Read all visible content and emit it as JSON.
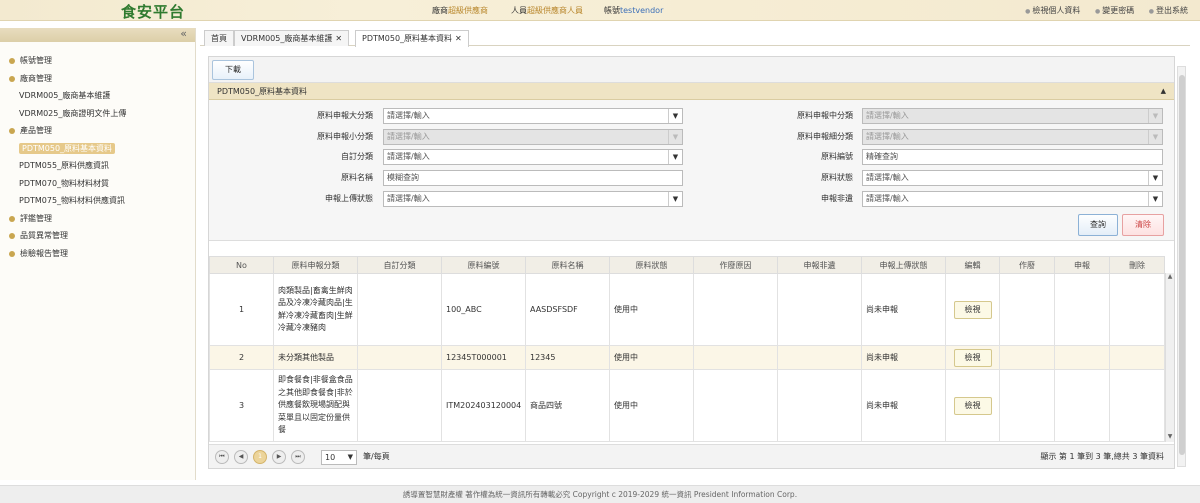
{
  "header": {
    "logo": "食安平台",
    "company_label": "廠商",
    "company_value": "超級供應商",
    "person_label": "人員",
    "person_value": "超級供應商人員",
    "account_label": "帳號",
    "account_value": "testvendor",
    "links": [
      "檢視個人資料",
      "變更密碼",
      "登出系統"
    ]
  },
  "sidebar": {
    "collapse_icon": "«",
    "groups": [
      {
        "label": "帳號管理"
      },
      {
        "label": "廠商管理",
        "items": [
          "VDRM005_廠商基本維護",
          "VDRM025_廠商證明文件上傳"
        ]
      },
      {
        "label": "產品管理",
        "items": [
          "PDTM050_原料基本資料",
          "PDTM055_原料供應資訊",
          "PDTM070_物料材料材質",
          "PDTM075_物料材料供應資訊"
        ]
      },
      {
        "label": "評鑑管理"
      },
      {
        "label": "品質異常管理"
      },
      {
        "label": "檢驗報告管理"
      }
    ],
    "active_item": "PDTM050_原料基本資料"
  },
  "tabs": [
    {
      "label": "首頁",
      "closable": false
    },
    {
      "label": "VDRM005_廠商基本維護",
      "closable": true
    },
    {
      "label": "PDTM050_原料基本資料",
      "closable": true,
      "active": true
    }
  ],
  "toolbar": {
    "download_label": "下載"
  },
  "section": {
    "title": "PDTM050_原料基本資料",
    "toggle": "▲"
  },
  "form": {
    "major_category": {
      "label": "原料申報大分類",
      "placeholder": "請選擇/輸入"
    },
    "middle_category": {
      "label": "原料申報中分類",
      "placeholder": "請選擇/輸入"
    },
    "minor_category": {
      "label": "原料申報小分類",
      "placeholder": "請選擇/輸入"
    },
    "detail_category": {
      "label": "原料申報細分類",
      "placeholder": "請選擇/輸入"
    },
    "custom_category": {
      "label": "自訂分類",
      "placeholder": "請選擇/輸入"
    },
    "material_code": {
      "label": "原料編號",
      "placeholder": "精確查詢"
    },
    "material_name": {
      "label": "原料名稱",
      "placeholder": "模糊查詢"
    },
    "material_status": {
      "label": "原料狀態",
      "placeholder": "請選擇/輸入"
    },
    "upload_status": {
      "label": "申報上傳狀態",
      "placeholder": "請選擇/輸入"
    },
    "declare_stage": {
      "label": "申報非遺",
      "placeholder": "請選擇/輸入"
    },
    "query_button": "查詢",
    "clear_button": "清除"
  },
  "table": {
    "columns": [
      "No",
      "原料申報分類",
      "自訂分類",
      "原料編號",
      "原料名稱",
      "原料狀態",
      "作廢原因",
      "申報非遺",
      "申報上傳狀態",
      "編輯",
      "作廢",
      "申報",
      "刪除"
    ],
    "rows": [
      {
        "no": "1",
        "category": "肉類製品|畜禽生鮮肉品及冷凍冷藏肉品|生鮮冷凍冷藏畜肉|生鮮冷藏冷凍豬肉",
        "custom": "",
        "code": "100_ABC",
        "name": "AASDSFSDF",
        "status": "使用中",
        "void_reason": "",
        "stage": "",
        "upload": "尚未申報",
        "view": "檢視"
      },
      {
        "no": "2",
        "category": "未分類其他製品",
        "custom": "",
        "code": "12345T000001",
        "name": "12345",
        "status": "使用中",
        "void_reason": "",
        "stage": "",
        "upload": "尚未申報",
        "view": "檢視"
      },
      {
        "no": "3",
        "category": "即食餐食|非餐盒食品之其他即食餐食|非於供應餐飲現場調配與菜單且以固定份量供餐",
        "custom": "",
        "code": "ITM202403120004",
        "name": "商品四號",
        "status": "使用中",
        "void_reason": "",
        "stage": "",
        "upload": "尚未申報",
        "view": "檢視"
      }
    ]
  },
  "pager": {
    "first": "⏮",
    "prev": "◀",
    "current": "1",
    "next": "▶",
    "last": "⏭",
    "page_size": "10",
    "unit": "筆/每頁",
    "info": "顯示 第 1 筆到 3 筆,總共 3 筆資料"
  },
  "footer": {
    "text": "誘導置智慧財產權 著作權為統一資訊所有轉載必究 Copyright c 2019-2029 統一資訊 President Information Corp."
  }
}
